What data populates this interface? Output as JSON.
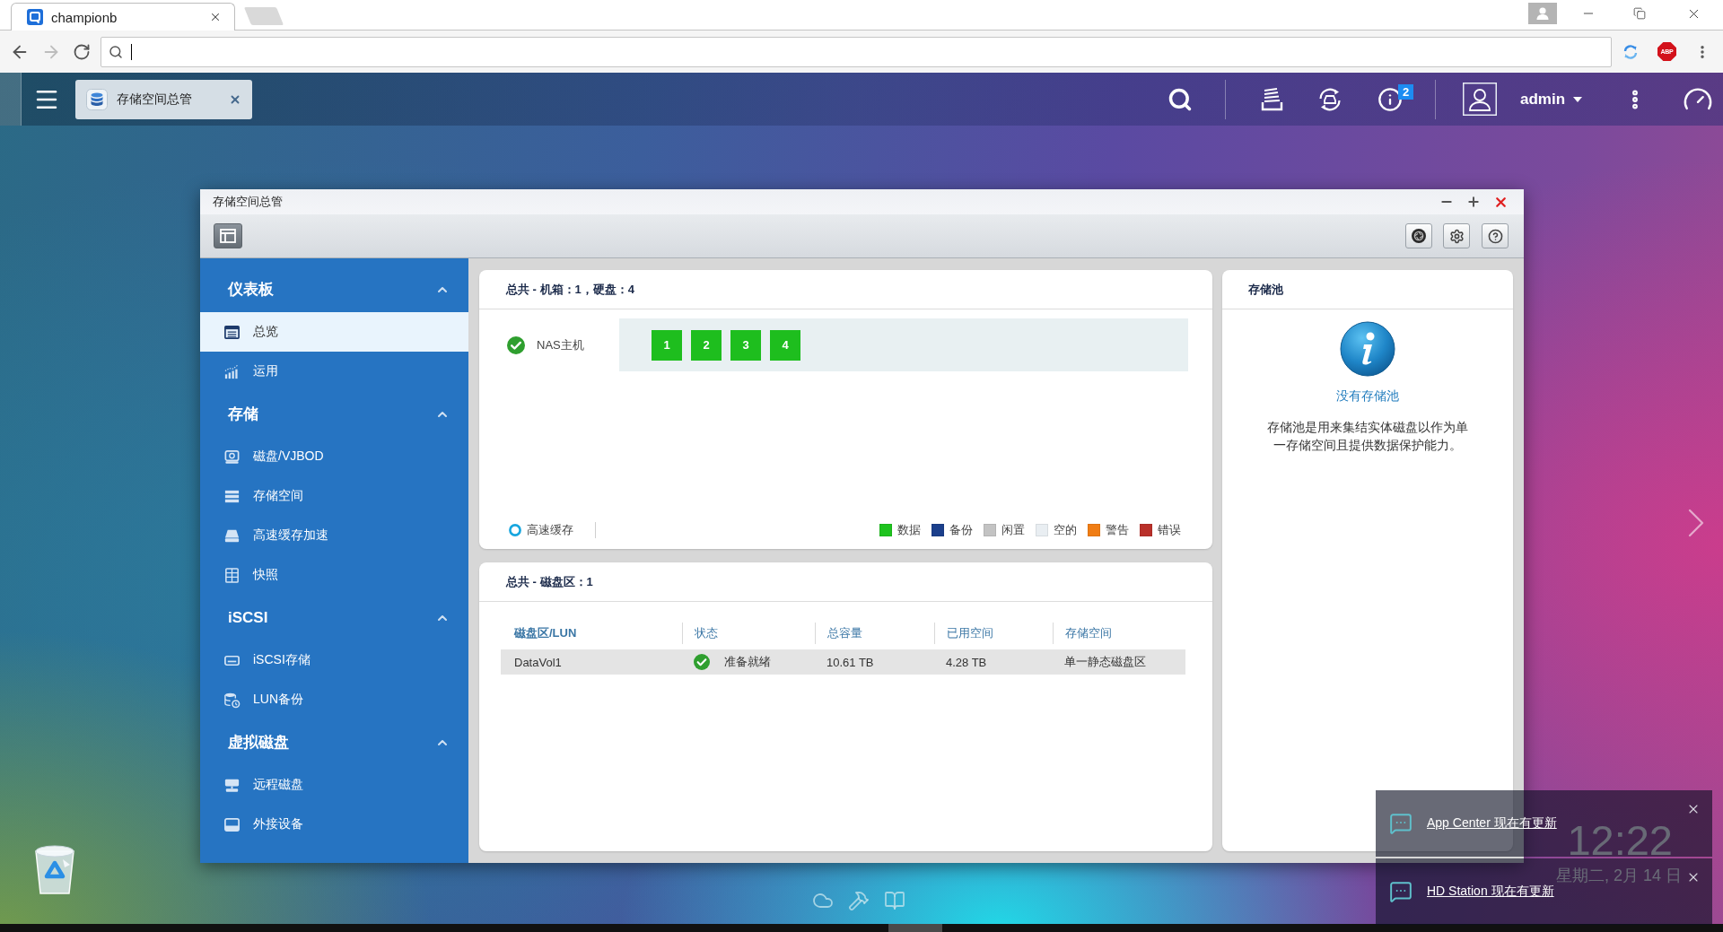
{
  "browser": {
    "tabs": [
      {
        "title": "championb",
        "selected": true
      }
    ],
    "adblock_badge": "ABP"
  },
  "topbar": {
    "app_tabs": [
      {
        "title": "存储空间总管",
        "selected": true
      }
    ],
    "notification_badge": "2",
    "user": "admin"
  },
  "window": {
    "title": "存储空间总管"
  },
  "sidebar": {
    "sections": [
      {
        "title": "仪表板",
        "expanded": true,
        "items": [
          {
            "label": "总览",
            "selected": true
          },
          {
            "label": "运用",
            "selected": false
          }
        ]
      },
      {
        "title": "存储",
        "expanded": true,
        "items": [
          {
            "label": "磁盘/VJBOD",
            "selected": false
          },
          {
            "label": "存储空间",
            "selected": false
          },
          {
            "label": "高速缓存加速",
            "selected": false
          },
          {
            "label": "快照",
            "selected": false
          }
        ]
      },
      {
        "title": "iSCSI",
        "expanded": true,
        "items": [
          {
            "label": "iSCSI存储",
            "selected": false
          },
          {
            "label": "LUN备份",
            "selected": false
          }
        ]
      },
      {
        "title": "虚拟磁盘",
        "expanded": true,
        "items": [
          {
            "label": "远程磁盘",
            "selected": false
          },
          {
            "label": "外接设备",
            "selected": false
          }
        ]
      }
    ]
  },
  "enclosure": {
    "title": "总共 - 机箱：1，硬盘：4",
    "host": {
      "name": "NAS主机",
      "healthy": true
    },
    "disks": [
      {
        "label": "1",
        "color": "#1ebe1e"
      },
      {
        "label": "2",
        "color": "#1ebe1e"
      },
      {
        "label": "3",
        "color": "#1ebe1e"
      },
      {
        "label": "4",
        "color": "#1ebe1e"
      }
    ],
    "cache": {
      "label": "高速缓存"
    },
    "legend": [
      {
        "label": "数据",
        "color": "#1ec31e"
      },
      {
        "label": "备份",
        "color": "#1b3f8b"
      },
      {
        "label": "闲置",
        "color": "#c3c3c3"
      },
      {
        "label": "空的",
        "color": "#e9eef2"
      },
      {
        "label": "警告",
        "color": "#f07d14"
      },
      {
        "label": "错误",
        "color": "#b9302a"
      }
    ]
  },
  "storage_pool": {
    "title": "存储池",
    "message": "没有存储池",
    "description": "存储池是用来集结实体磁盘以作为单一存储空间且提供数据保护能力。"
  },
  "volumes": {
    "title": "总共 - 磁盘区：1",
    "table": {
      "columns": [
        {
          "label": "磁盘区/LUN",
          "sorted": true
        },
        {
          "label": "状态",
          "sorted": false
        },
        {
          "label": "总容量",
          "sorted": false
        },
        {
          "label": "已用空间",
          "sorted": false
        },
        {
          "label": "存储空间",
          "sorted": false
        }
      ],
      "rows": [
        {
          "cells": [
            "DataVol1",
            "准备就绪",
            "10.61 TB",
            "4.28 TB",
            "单一静态磁盘区"
          ],
          "ready": true,
          "selected": true
        }
      ]
    }
  },
  "clock": {
    "time": "12:22",
    "date": "星期二, 2月 14 日"
  },
  "notifications": [
    {
      "text": "App Center 现在有更新"
    },
    {
      "text": "HD Station 现在有更新"
    }
  ]
}
